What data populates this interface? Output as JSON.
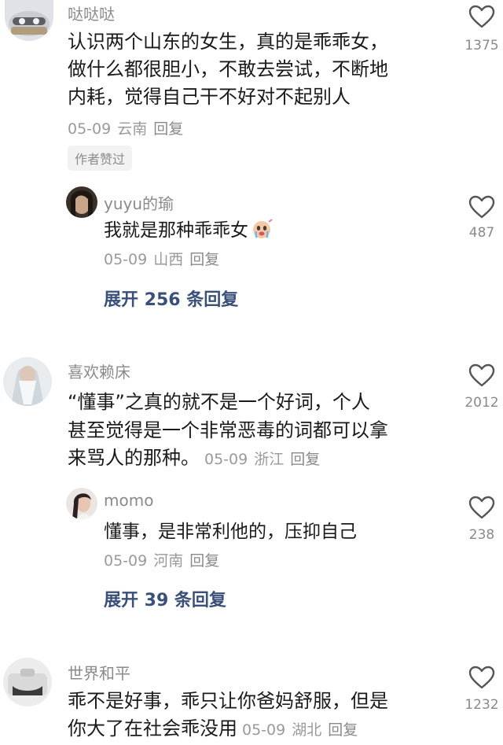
{
  "comments": [
    {
      "username": "哒哒哒",
      "lines": [
        "认识两个山东的女生，真的是乖乖女，",
        "做什么都很胆小，不敢去尝试，不断地",
        "内耗，觉得自己干不好对不起别人"
      ],
      "date": "05-09",
      "location": "云南",
      "reply_label": "回复",
      "badge": "作者赞过",
      "likes": "1375",
      "reply": {
        "username": "yuyu的瑜",
        "text": "我就是那种乖乖女",
        "emoji": "crying-face-emoji",
        "date": "05-09",
        "location": "山西",
        "reply_label": "回复",
        "likes": "487"
      },
      "expand_label": "展开 256 条回复"
    },
    {
      "username": "喜欢赖床",
      "lines": [
        "“懂事”之真的就不是一个好词，个人",
        "甚至觉得是一个非常恶毒的词都可以拿"
      ],
      "last_line": "来骂人的那种。",
      "date": "05-09",
      "location": "浙江",
      "reply_label": "回复",
      "likes": "2012",
      "reply": {
        "username": "momo",
        "text": "懂事，是非常利他的，压抑自己",
        "date": "05-09",
        "location": "河南",
        "reply_label": "回复",
        "likes": "238"
      },
      "expand_label": "展开 39 条回复"
    },
    {
      "username": "世界和平",
      "lines": [
        "乖不是好事，乖只让你爸妈舒服，但是"
      ],
      "last_line": "你大了在社会乖没用",
      "date": "05-09",
      "location": "湖北",
      "reply_label": "回复",
      "likes": "1232"
    }
  ],
  "icons": {
    "like": "heart-outline-icon"
  },
  "colors": {
    "expand_link": "#3a5079",
    "meta": "#9a9a9a"
  }
}
